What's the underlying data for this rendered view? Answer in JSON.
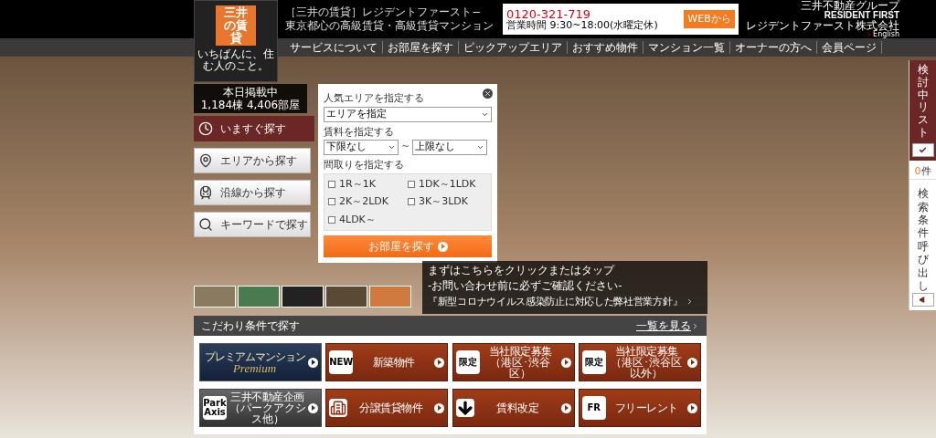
{
  "logo": {
    "name": "三井の賃貸",
    "slogan": "いちばんに、住む人のこと。"
  },
  "header": {
    "tagline": [
      "［三井の賃貸］レジデントファースト−",
      "東京都心の高級賃貸・高級賃貸マンション"
    ],
    "phone": "0120-321-719",
    "hours": "営業時間 9:30~18:00(水曜定休)",
    "web_button": "WEBから",
    "brand_group": "三井不動産グループ",
    "brand": "RESIDENT FIRST",
    "brand_sub": "レジデントファースト株式会社",
    "english": "English"
  },
  "nav": [
    "サービスについて",
    "お部屋を探す",
    "ピックアップエリア",
    "おすすめ物件",
    "マンション一覧",
    "オーナーの方へ",
    "会員ページ"
  ],
  "listing": {
    "label": "本日掲載中",
    "count": "1,184棟 4,406部屋"
  },
  "search_tabs": [
    {
      "label": "いますぐ探す",
      "kind": "clock",
      "selected": true
    },
    {
      "label": "エリアから探す",
      "kind": "pin",
      "selected": false
    },
    {
      "label": "沿線から探す",
      "kind": "train",
      "selected": false
    },
    {
      "label": "キーワードで探す",
      "kind": "search",
      "selected": false
    }
  ],
  "search": {
    "area_label": "人気エリアを指定する",
    "area_value": "エリアを指定",
    "rent_label": "賃料を指定する",
    "rent_min": "下限なし",
    "tilde": "~",
    "rent_max": "上限なし",
    "layout_label": "間取りを指定する",
    "layouts": [
      {
        "label": "1R～1K",
        "checked": false
      },
      {
        "label": "1DK～1LDK",
        "checked": false
      },
      {
        "label": "2K～2LDK",
        "checked": false
      },
      {
        "label": "3K～3LDK",
        "checked": false
      },
      {
        "label": "4LDK～",
        "checked": false
      }
    ],
    "submit": "お部屋を探す"
  },
  "notice": [
    "まずはこちらをクリックまたはタップ",
    "-お問い合わせ前に必ずご確認ください-",
    "『新型コロナウイルス感染防止に対応した弊社営業方針』"
  ],
  "conditions": {
    "title": "こだわり条件で探す",
    "more": "一覧を見る",
    "buttons": [
      {
        "kind": "premium",
        "badge": "プレミアムマンション",
        "label": "Premium"
      },
      {
        "kind": "badge",
        "badge": "NEW",
        "label": "新築物件"
      },
      {
        "kind": "badge",
        "badge": "限定",
        "label": "当社限定募集",
        "sub": "（港区･渋谷区）"
      },
      {
        "kind": "badge",
        "badge": "限定",
        "label": "当社限定募集",
        "sub": "（港区･渋谷区以外）"
      },
      {
        "kind": "dark",
        "badge": "Park Axis",
        "label": "三井不動産企画",
        "sub": "（パークアクシス他）"
      },
      {
        "kind": "building",
        "label": "分譲賃貸物件"
      },
      {
        "kind": "down",
        "label": "賃料改定"
      },
      {
        "kind": "badge",
        "badge": "FR",
        "label": "フリーレント"
      }
    ]
  },
  "sidebar": {
    "title": "検討中リスト",
    "count": "0",
    "unit": "件",
    "recall": "検索条件呼び出し"
  }
}
